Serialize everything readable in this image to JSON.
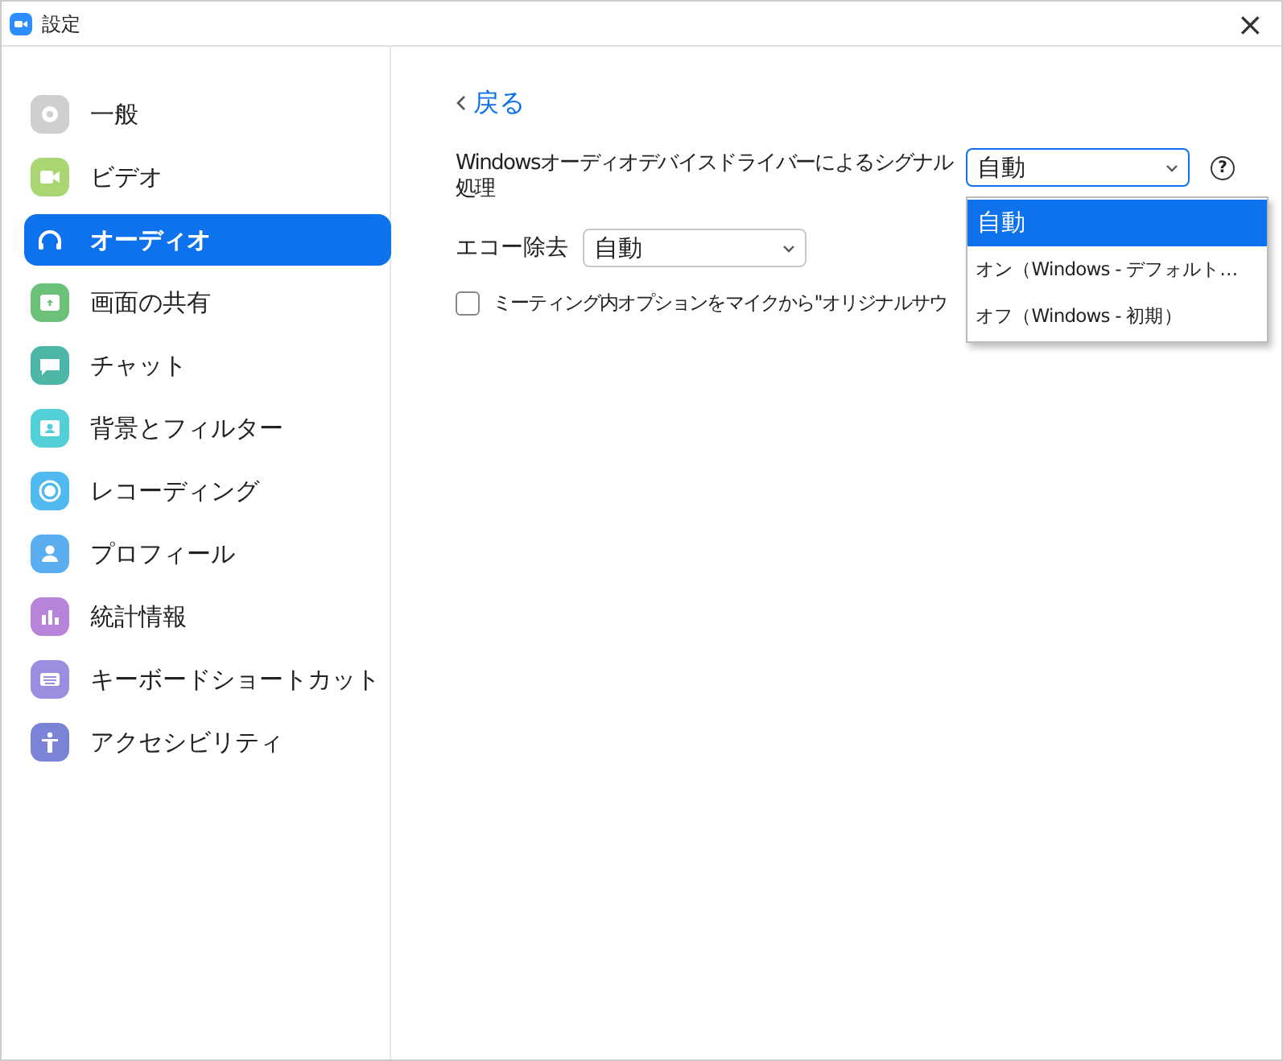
{
  "window": {
    "title": "設定",
    "close": "×"
  },
  "sidebar": {
    "items": [
      {
        "label": "一般",
        "color": "#cfcfcf",
        "selected": false
      },
      {
        "label": "ビデオ",
        "color": "#a9d672",
        "selected": false
      },
      {
        "label": "オーディオ",
        "color": "#0e72ed",
        "selected": true
      },
      {
        "label": "画面の共有",
        "color": "#6cc17a",
        "selected": false
      },
      {
        "label": "チャット",
        "color": "#4db6a7",
        "selected": false
      },
      {
        "label": "背景とフィルター",
        "color": "#53cfd8",
        "selected": false
      },
      {
        "label": "レコーディング",
        "color": "#4fb9f0",
        "selected": false
      },
      {
        "label": "プロフィール",
        "color": "#5aaef0",
        "selected": false
      },
      {
        "label": "統計情報",
        "color": "#b884d9",
        "selected": false
      },
      {
        "label": "キーボードショートカット",
        "color": "#9a8ee0",
        "selected": false
      },
      {
        "label": "アクセシビリティ",
        "color": "#7a83d6",
        "selected": false
      }
    ]
  },
  "back": {
    "label": "戻る"
  },
  "signal_processing": {
    "label": "Windowsオーディオデバイスドライバーによるシグナル処理",
    "value": "自動",
    "help": "?",
    "expanded": true,
    "options": [
      {
        "label": "自動",
        "selected": true
      },
      {
        "label": "オン（Windows - デフォルト…",
        "selected": false
      },
      {
        "label": "オフ（Windows - 初期）",
        "selected": false
      }
    ]
  },
  "echo_cancellation": {
    "label": "エコー除去",
    "value": "自動"
  },
  "original_sound_option": {
    "label": "ミーティング内オプションをマイクから\"オリジナルサウ",
    "checked": false
  }
}
